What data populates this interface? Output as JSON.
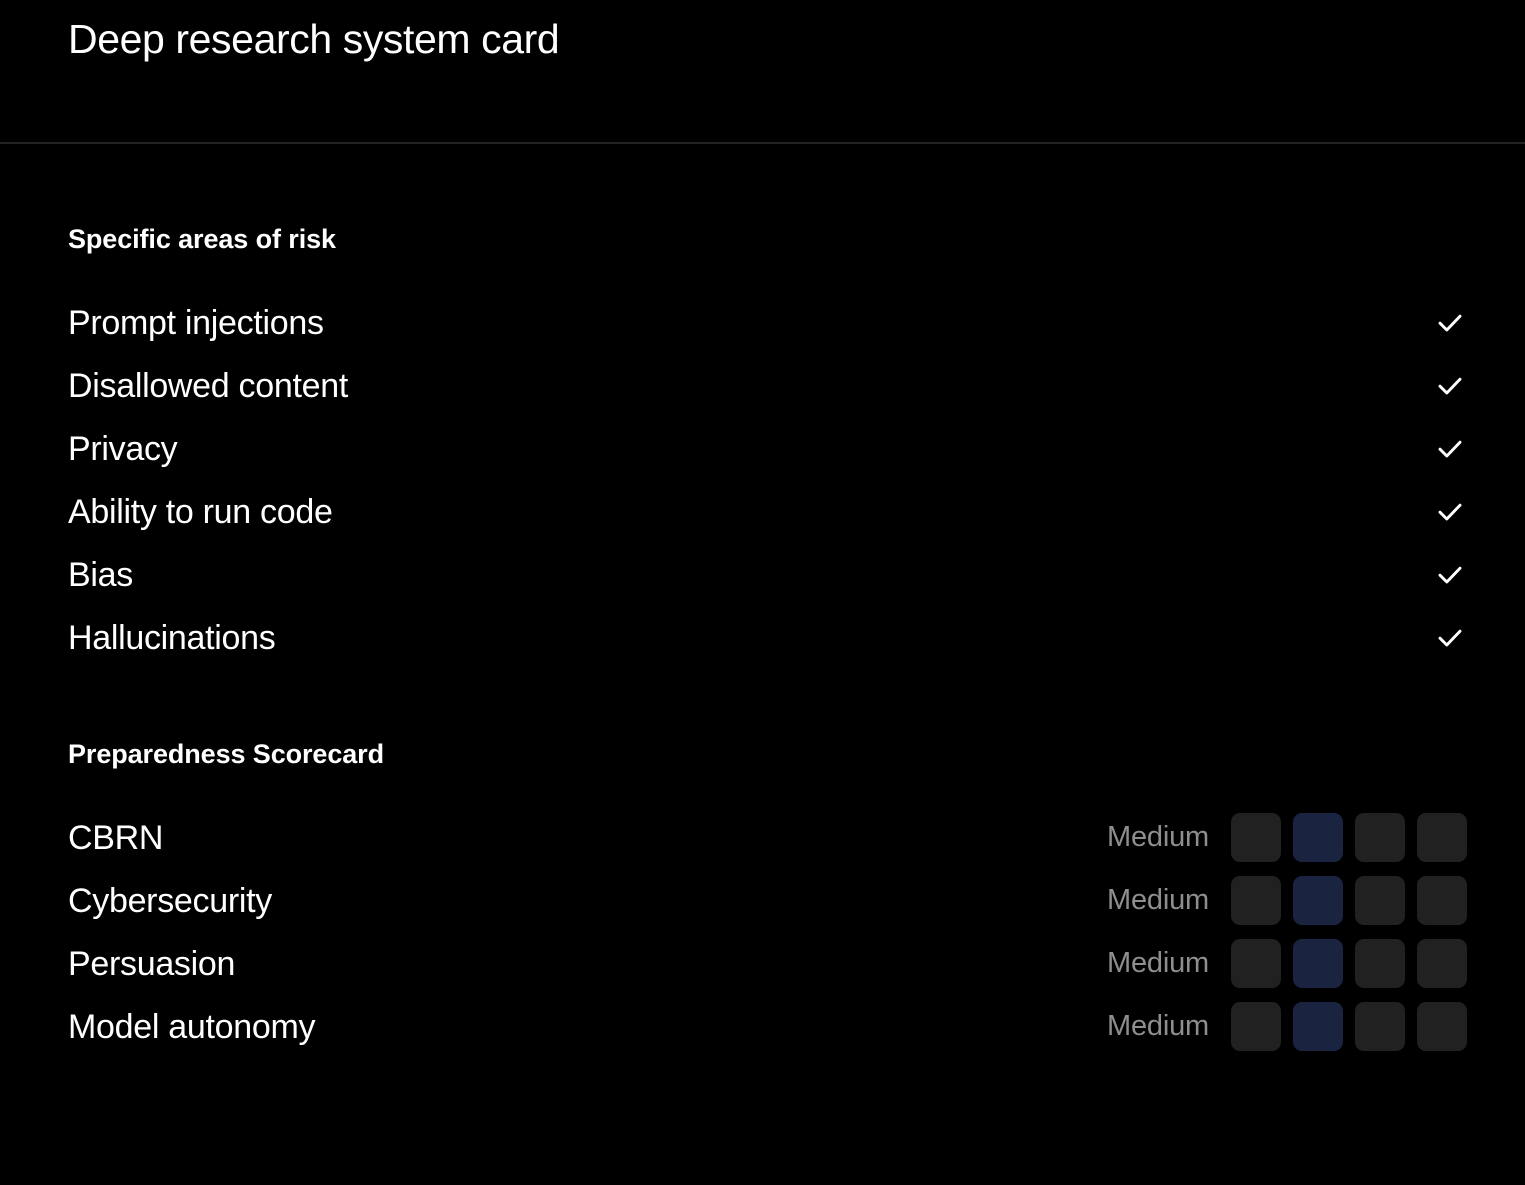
{
  "header": {
    "title": "Deep research system card"
  },
  "colors": {
    "background": "#000000",
    "divider": "#232323",
    "text_primary": "#ffffff",
    "text_muted": "#8e8e8e",
    "level_inactive": "#212121",
    "level_active": "#1a2340"
  },
  "risk_section": {
    "heading": "Specific areas of risk",
    "check_icon": "check-icon",
    "items": [
      {
        "label": "Prompt injections",
        "checked": true
      },
      {
        "label": "Disallowed content",
        "checked": true
      },
      {
        "label": "Privacy",
        "checked": true
      },
      {
        "label": "Ability to run code",
        "checked": true
      },
      {
        "label": "Bias",
        "checked": true
      },
      {
        "label": "Hallucinations",
        "checked": true
      }
    ]
  },
  "scorecard_section": {
    "heading": "Preparedness Scorecard",
    "levels_count": 4,
    "items": [
      {
        "label": "CBRN",
        "rating": "Medium",
        "level_index": 1
      },
      {
        "label": "Cybersecurity",
        "rating": "Medium",
        "level_index": 1
      },
      {
        "label": "Persuasion",
        "rating": "Medium",
        "level_index": 1
      },
      {
        "label": "Model autonomy",
        "rating": "Medium",
        "level_index": 1
      }
    ]
  }
}
